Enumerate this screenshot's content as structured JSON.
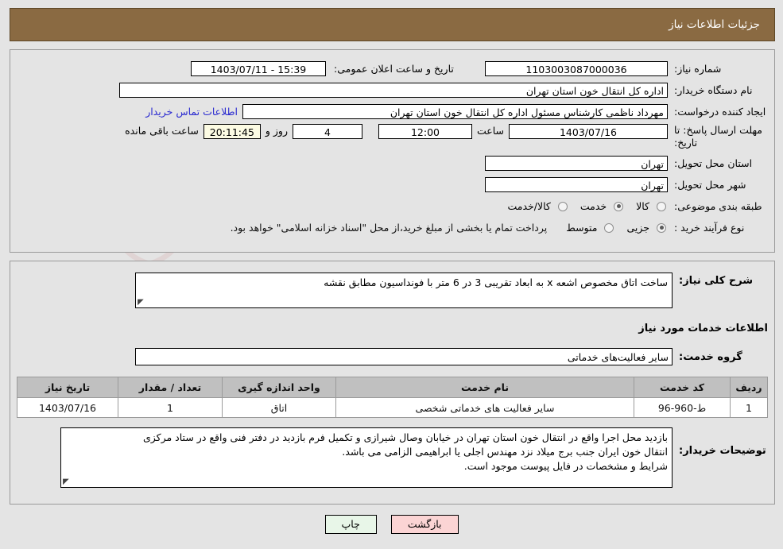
{
  "header": {
    "title": "جزئیات اطلاعات نیاز"
  },
  "form": {
    "need_number_label": "شماره نیاز:",
    "need_number_value": "1103003087000036",
    "public_announce_label": "تاریخ و ساعت اعلان عمومی:",
    "public_announce_value": "15:39 - 1403/07/11",
    "buyer_org_label": "نام دستگاه خریدار:",
    "buyer_org_value": "اداره کل انتقال خون استان تهران",
    "creator_label": "ایجاد کننده درخواست:",
    "creator_value": "مهرداد ناظمی کارشناس مسئول اداره کل انتقال خون استان تهران",
    "contact_link": "اطلاعات تماس خریدار",
    "deadline_label": "مهلت ارسال پاسخ: تا تاریخ:",
    "deadline_date": "1403/07/16",
    "hour_label": "ساعت",
    "hour_value": "12:00",
    "days_value": "4",
    "days_label": "روز و",
    "countdown_value": "20:11:45",
    "countdown_label": "ساعت باقی مانده",
    "province_label": "استان محل تحویل:",
    "province_value": "تهران",
    "city_label": "شهر محل تحویل:",
    "city_value": "تهران",
    "classification_label": "طبقه بندی موضوعی:",
    "classification_options": [
      {
        "label": "کالا",
        "selected": false
      },
      {
        "label": "خدمت",
        "selected": true
      },
      {
        "label": "کالا/خدمت",
        "selected": false
      }
    ],
    "process_label": "نوع فرآیند خرید :",
    "process_options": [
      {
        "label": "جزیی",
        "selected": true
      },
      {
        "label": "متوسط",
        "selected": false
      }
    ],
    "treasury_note": "پرداخت تمام یا بخشی از مبلغ خرید،از محل \"اسناد خزانه اسلامی\" خواهد بود."
  },
  "middle": {
    "general_desc_label": "شرح کلی نیاز:",
    "general_desc_value": "ساخت اتاق مخصوص اشعه x به ابعاد تقریبی 3 در 6 متر با فونداسیون مطابق نقشه",
    "services_section_title": "اطلاعات خدمات مورد نیاز",
    "service_group_label": "گروه خدمت:",
    "service_group_value": "سایر فعالیت‌های خدماتی"
  },
  "table": {
    "headers": [
      "ردیف",
      "کد خدمت",
      "نام خدمت",
      "واحد اندازه گیری",
      "تعداد / مقدار",
      "تاریخ نیاز"
    ],
    "rows": [
      {
        "row_no": "1",
        "service_code": "ط-960-96",
        "service_name": "سایر فعالیت های خدماتی شخصی",
        "unit": "اتاق",
        "quantity": "1",
        "need_date": "1403/07/16"
      }
    ]
  },
  "buyer_notes": {
    "label": "توضیحات خریدار:",
    "lines": [
      "بازدید محل اجرا واقع در انتقال خون استان تهران در خیابان وصال شیرازی و تکمیل فرم بازدید در دفتر فنی واقع در ستاد مرکزی",
      "انتقال خون ایران جنب برج میلاد نزد مهندس اجلی یا ابراهیمی الزامی می باشد.",
      "شرایط و مشخصات در فایل پیوست موجود است."
    ]
  },
  "buttons": {
    "print": "چاپ",
    "back": "بازگشت"
  },
  "watermark": {
    "text": "AnaTender.net"
  },
  "colors": {
    "header_bg": "#8a6a42",
    "link": "#2a2ad0",
    "table_header_bg": "#c0c0c0",
    "print_btn_bg": "#e8f6e8",
    "back_btn_bg": "#fbd4d4",
    "countdown_bg": "#fcfbe3",
    "page_bg": "#e4e4e4"
  }
}
